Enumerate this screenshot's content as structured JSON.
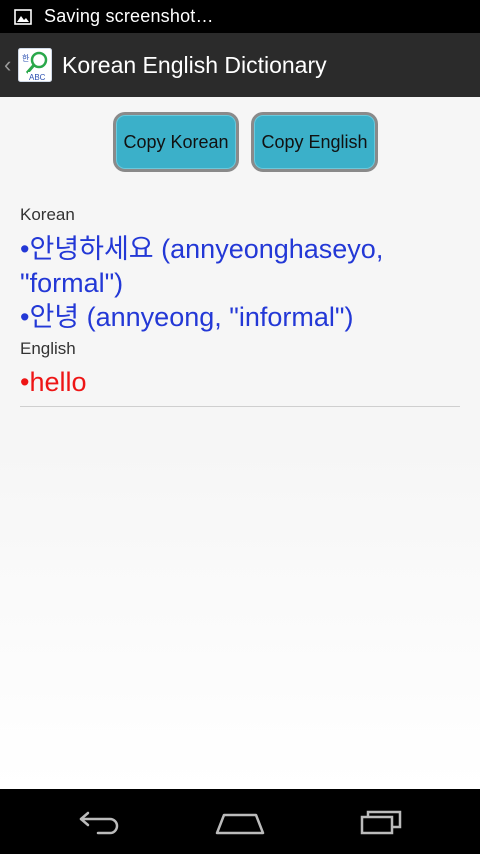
{
  "status_bar": {
    "notification_icon": "image-icon",
    "text": "Saving screenshot…"
  },
  "action_bar": {
    "up_icon": "chevron-left-icon",
    "app_icon": "dictionary-app-icon",
    "title": "Korean English Dictionary"
  },
  "buttons": {
    "copy_korean": "Copy Korean",
    "copy_english": "Copy English"
  },
  "result": {
    "korean_label": "Korean",
    "korean_entries": [
      "•안녕하세요 (annyeonghaseyo, \"formal\")",
      "•안녕 (annyeong, \"informal\")"
    ],
    "english_label": "English",
    "english_entries": [
      "•hello"
    ]
  },
  "nav_bar": {
    "back_icon": "back-icon",
    "home_icon": "home-icon",
    "recents_icon": "recents-icon"
  },
  "colors": {
    "korean_text": "#2338d6",
    "english_text": "#ee1515",
    "button_bg": "#3bb0c9"
  }
}
